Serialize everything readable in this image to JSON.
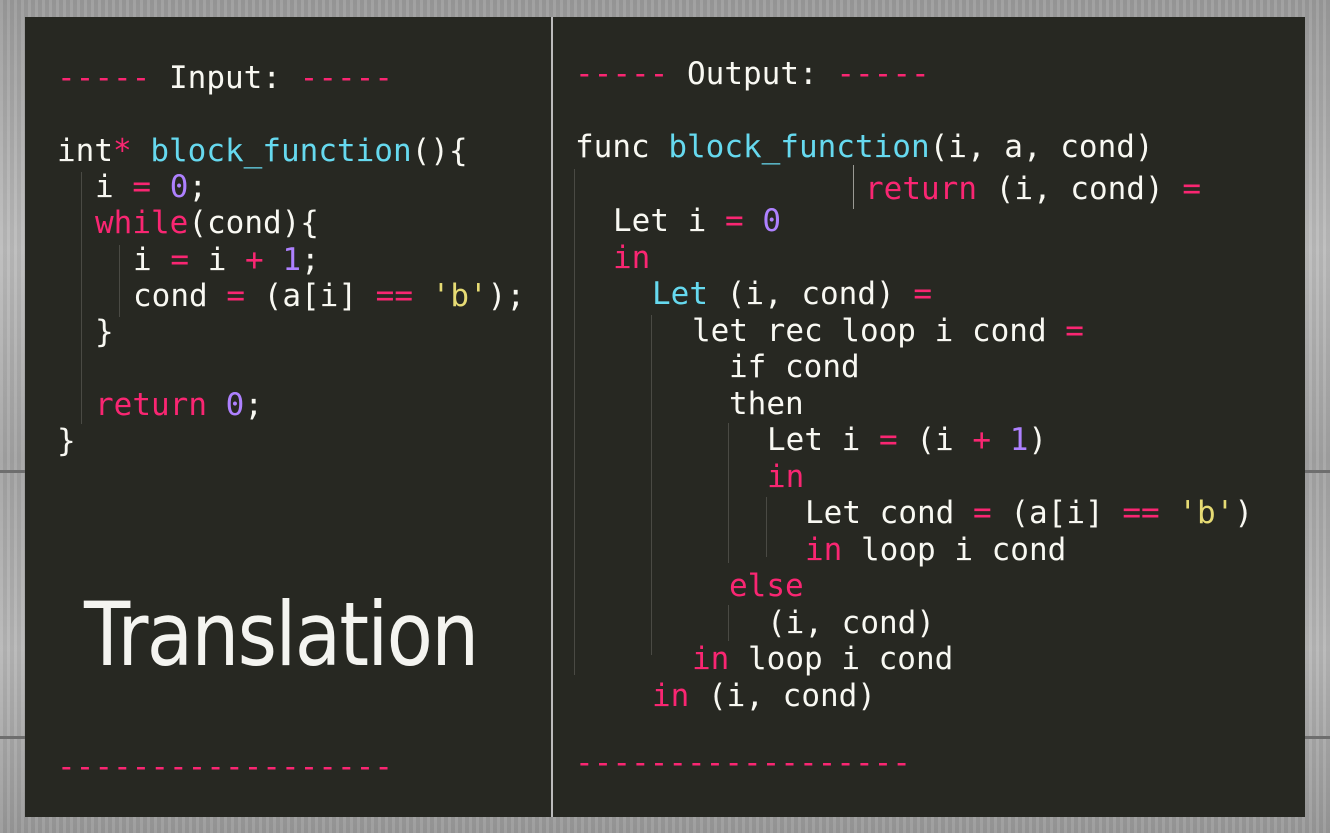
{
  "input_panel": {
    "header_dashes_left": "-----",
    "header_label": "Input:",
    "header_dashes_right": "-----",
    "code": {
      "l1_type": "int",
      "l1_ptr": "*",
      "l1_fn": "block_function",
      "l1_tail": "(){",
      "l2_var": "i",
      "l2_eq": "=",
      "l2_num": "0",
      "l2_semi": ";",
      "l3_kw": "while",
      "l3_tail": "(cond){",
      "l4_a": "i",
      "l4_eq": "=",
      "l4_b": "i",
      "l4_plus": "+",
      "l4_num": "1",
      "l4_semi": ";",
      "l5_var": "cond",
      "l5_eq": "=",
      "l5_expr": "(a[i]",
      "l5_cmp": "==",
      "l5_str": "'b'",
      "l5_tail": ");",
      "l6_close": "}",
      "l7_kw": "return",
      "l7_num": "0",
      "l7_semi": ";",
      "l8_close": "}"
    },
    "footer_dashes": "------------------"
  },
  "title": "Translation",
  "output_panel": {
    "header_dashes_left": "-----",
    "header_label": "Output:",
    "header_dashes_right": "-----",
    "code": {
      "o1_kw": "func",
      "o1_fn": "block_function",
      "o1_args": "(i, a, cond)",
      "o2_kw": "return",
      "o2_tuple": "(i, cond)",
      "o2_eq": "=",
      "o3_kw": "Let",
      "o3_var": "i",
      "o3_eq": "=",
      "o3_num": "0",
      "o4_in": "in",
      "o5_kw": "Let",
      "o5_tuple": "(i, cond)",
      "o5_eq": "=",
      "o6_text": "let rec loop i cond",
      "o6_eq": "=",
      "o7_text": "if cond",
      "o8_text": "then",
      "o9_kw": "Let",
      "o9_var": "i",
      "o9_eq": "=",
      "o9_open": "(i",
      "o9_plus": "+",
      "o9_num": "1",
      "o9_close": ")",
      "o10_in": "in",
      "o11_kw": "Let",
      "o11_var": "cond",
      "o11_eq": "=",
      "o11_expr": "(a[i]",
      "o11_cmp": "==",
      "o11_str": "'b'",
      "o11_close": ")",
      "o12_in": "in",
      "o12_text": "loop i cond",
      "o13_kw": "else",
      "o14_text": "(i, cond)",
      "o15_in": "in",
      "o15_text": "loop i cond",
      "o16_in": "in",
      "o16_text": "(i, cond)"
    },
    "footer_dashes": "------------------"
  },
  "colors": {
    "background": "#272822",
    "keyword": "#f92672",
    "function": "#66d9ef",
    "number": "#ae81ff",
    "string": "#e6db74",
    "text": "#f8f8f2"
  }
}
